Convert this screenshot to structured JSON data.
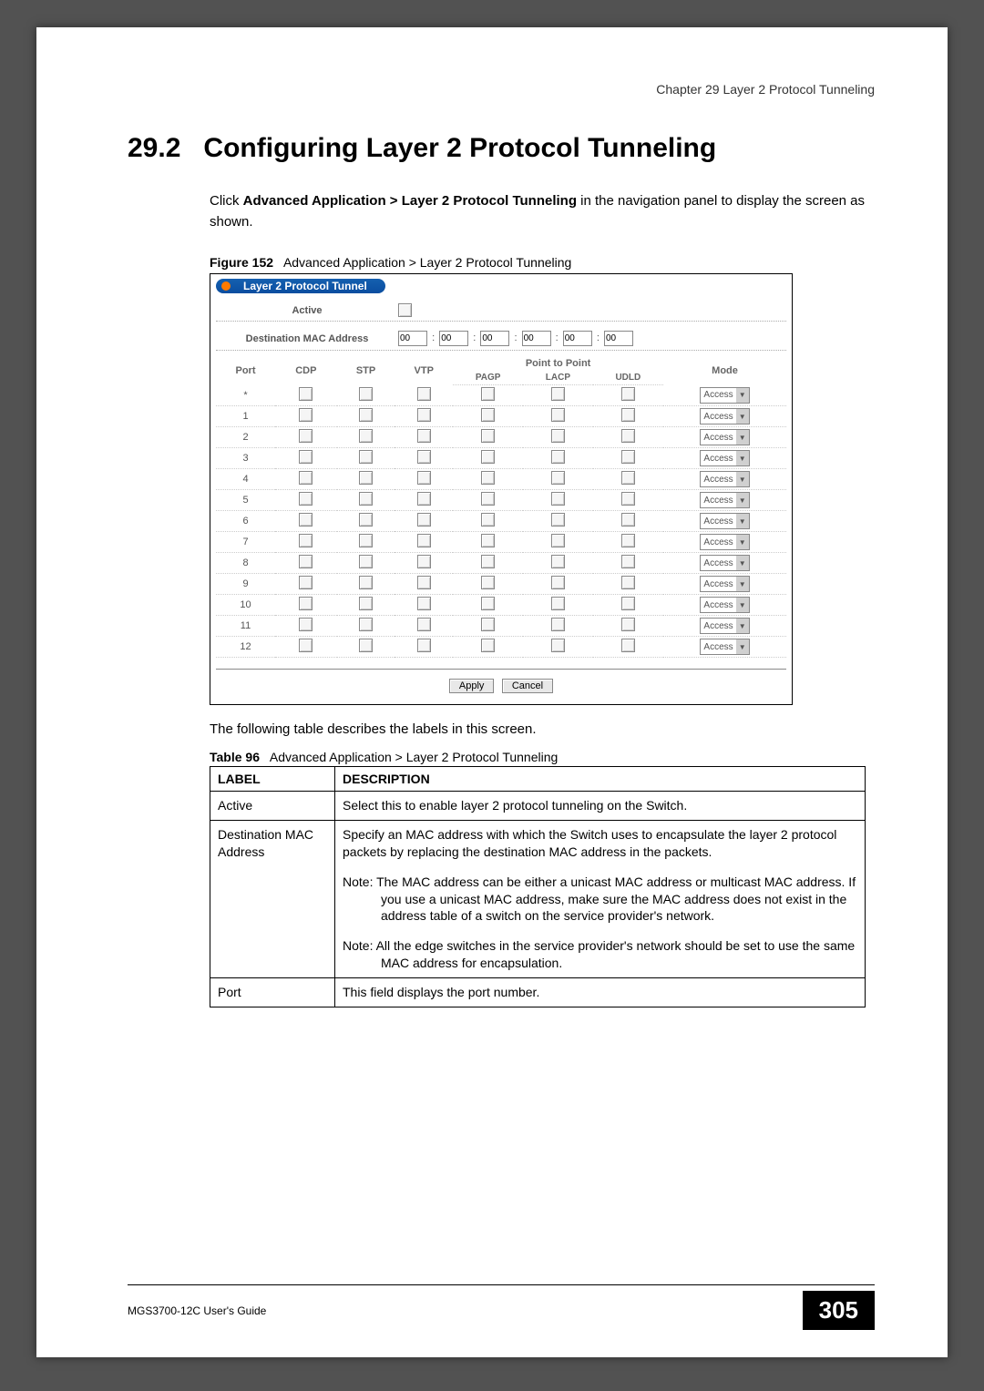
{
  "header": {
    "chapter": "Chapter 29 Layer 2 Protocol Tunneling"
  },
  "section": {
    "number": "29.2",
    "title": "Configuring Layer 2 Protocol Tunneling",
    "intro_prefix": "Click ",
    "intro_bold": "Advanced Application > Layer 2 Protocol Tunneling",
    "intro_suffix": " in the navigation panel to display the screen as shown."
  },
  "figure": {
    "label": "Figure 152",
    "caption": "Advanced Application > Layer 2 Protocol Tunneling",
    "tab_title": "Layer 2 Protocol Tunnel",
    "config": {
      "active_label": "Active",
      "mac_label": "Destination MAC Address",
      "mac_octets": [
        "00",
        "00",
        "00",
        "00",
        "00",
        "00"
      ]
    },
    "columns": {
      "port": "Port",
      "cdp": "CDP",
      "stp": "STP",
      "vtp": "VTP",
      "ptp": "Point to Point",
      "pagp": "PAGP",
      "lacp": "LACP",
      "udld": "UDLD",
      "mode": "Mode"
    },
    "rows": [
      {
        "port": "*",
        "mode": "Access"
      },
      {
        "port": "1",
        "mode": "Access"
      },
      {
        "port": "2",
        "mode": "Access"
      },
      {
        "port": "3",
        "mode": "Access"
      },
      {
        "port": "4",
        "mode": "Access"
      },
      {
        "port": "5",
        "mode": "Access"
      },
      {
        "port": "6",
        "mode": "Access"
      },
      {
        "port": "7",
        "mode": "Access"
      },
      {
        "port": "8",
        "mode": "Access"
      },
      {
        "port": "9",
        "mode": "Access"
      },
      {
        "port": "10",
        "mode": "Access"
      },
      {
        "port": "11",
        "mode": "Access"
      },
      {
        "port": "12",
        "mode": "Access"
      }
    ],
    "buttons": {
      "apply": "Apply",
      "cancel": "Cancel"
    }
  },
  "after_figure": "The following table describes the labels in this screen.",
  "table": {
    "label": "Table 96",
    "caption": "Advanced Application > Layer 2 Protocol Tunneling",
    "head_label": "LABEL",
    "head_desc": "DESCRIPTION",
    "rows": [
      {
        "label": "Active",
        "desc": "Select this to enable layer 2 protocol tunneling on the Switch."
      },
      {
        "label": "Destination MAC Address",
        "desc": "Specify an MAC address with which the Switch uses to encapsulate the layer 2 protocol packets by replacing the destination MAC address in the packets.",
        "note1": "Note: The MAC address can be either a unicast MAC address or multicast MAC address. If you use a unicast MAC address, make sure the MAC address does not exist in the address table of a switch on the service provider's network.",
        "note2": "Note: All the edge switches in the service provider's network should be set to use the same MAC address for encapsulation."
      },
      {
        "label": "Port",
        "desc": "This field displays the port number."
      }
    ]
  },
  "footer": {
    "guide": "MGS3700-12C User's Guide",
    "page": "305"
  }
}
